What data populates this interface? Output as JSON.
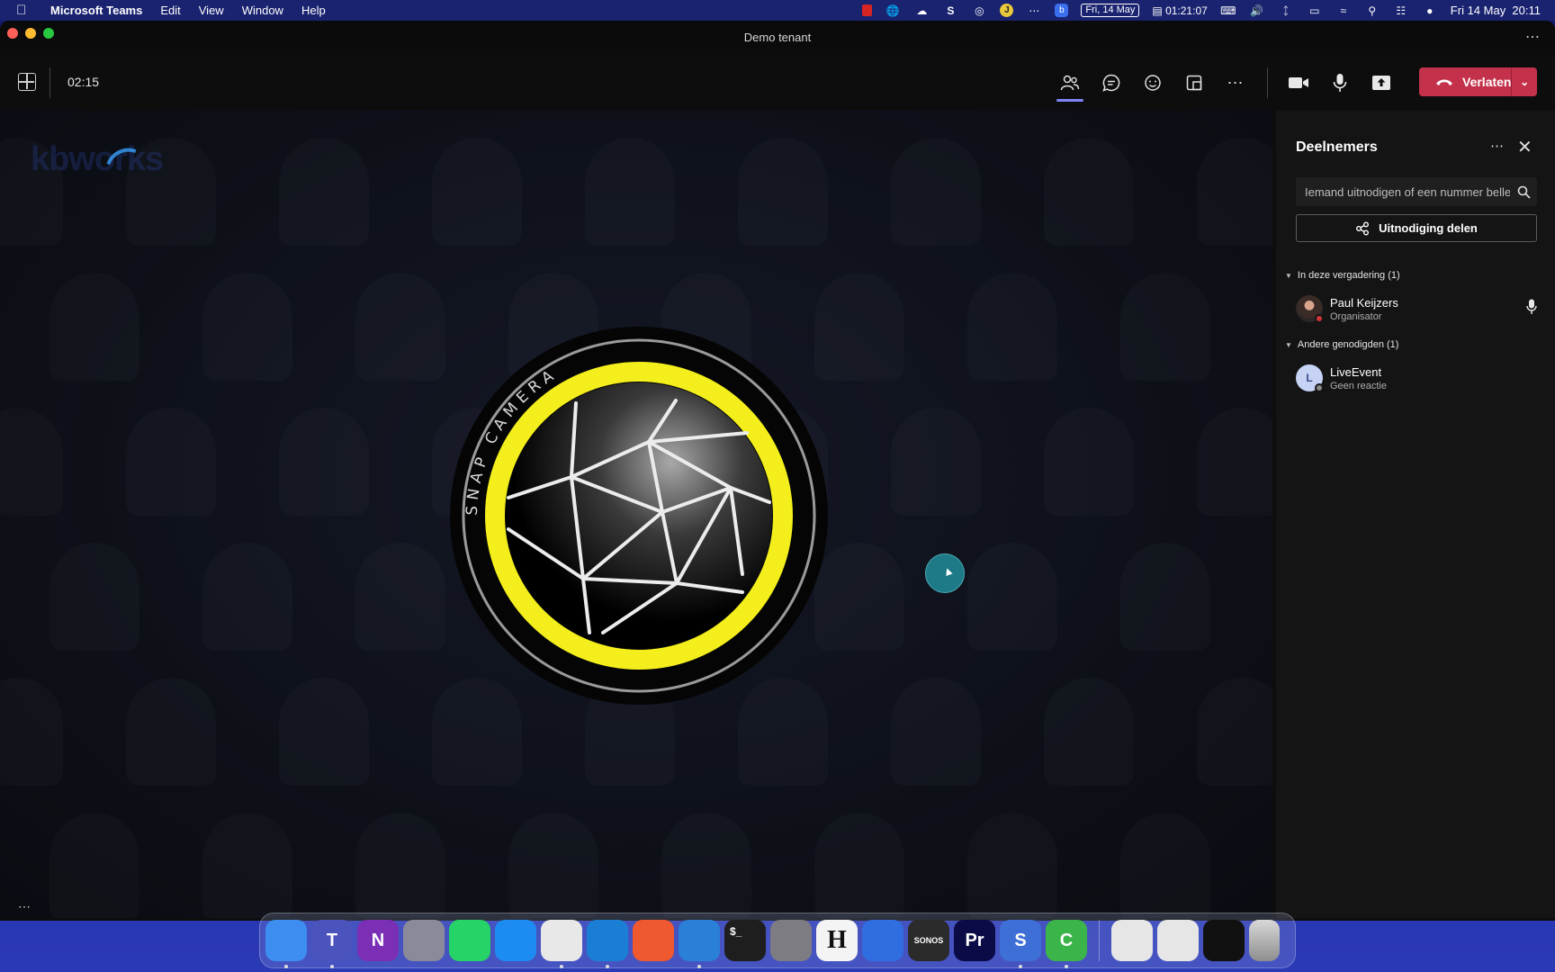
{
  "menubar": {
    "app_name": "Microsoft Teams",
    "menus": [
      "Edit",
      "View",
      "Window",
      "Help"
    ],
    "date_badge": "Fri, 14 May",
    "timer": "01:21:07",
    "datetime": "Fri 14 May  20:11"
  },
  "window": {
    "title": "Demo tenant",
    "more": "⋯"
  },
  "toolbar": {
    "elapsed": "02:15",
    "leave_label": "Verlaten"
  },
  "stage": {
    "watermark": "kbworks",
    "logo_text": "SNAP CAMERA",
    "more": "⋯"
  },
  "panel": {
    "title": "Deelnemers",
    "search_placeholder": "Iemand uitnodigen of een nummer bellen",
    "share_label": "Uitnodiging delen",
    "sections": [
      {
        "label": "In deze vergadering (1)",
        "people": [
          {
            "name": "Paul Keijzers",
            "role": "Organisator",
            "initial": ""
          }
        ]
      },
      {
        "label": "Andere genodigden (1)",
        "people": [
          {
            "name": "LiveEvent",
            "role": "Geen reactie",
            "initial": "L"
          }
        ]
      }
    ]
  },
  "dock": {
    "apps": [
      {
        "name": "Finder",
        "color": "#3d8ef0"
      },
      {
        "name": "Microsoft Teams",
        "color": "#4b53bc",
        "label": "T"
      },
      {
        "name": "OneNote",
        "color": "#7b2fb5",
        "label": "N"
      },
      {
        "name": "Launchpad",
        "color": "#8a8a9a"
      },
      {
        "name": "WhatsApp",
        "color": "#25d366"
      },
      {
        "name": "Safari",
        "color": "#1d8cf2"
      },
      {
        "name": "Chrome",
        "color": "#e8e8e8"
      },
      {
        "name": "Edge",
        "color": "#1a7fd4"
      },
      {
        "name": "Brave",
        "color": "#f0582f"
      },
      {
        "name": "Visual Studio Code",
        "color": "#2a7fd6"
      },
      {
        "name": "Terminal",
        "color": "#1e1e1e",
        "label": "$_"
      },
      {
        "name": "System Preferences",
        "color": "#7c7c82"
      },
      {
        "name": "Hemingway",
        "color": "#f4f4f4",
        "label": "H"
      },
      {
        "name": "Microsoft To Do",
        "color": "#2f6de0"
      },
      {
        "name": "Sonos",
        "color": "#2b2b2b",
        "label": "SONOS"
      },
      {
        "name": "Premiere Pro",
        "color": "#0b0b47",
        "label": "Pr"
      },
      {
        "name": "Snagit",
        "color": "#3d6fd6",
        "label": "S"
      },
      {
        "name": "Camtasia",
        "color": "#3bb54a",
        "label": "C"
      }
    ]
  }
}
